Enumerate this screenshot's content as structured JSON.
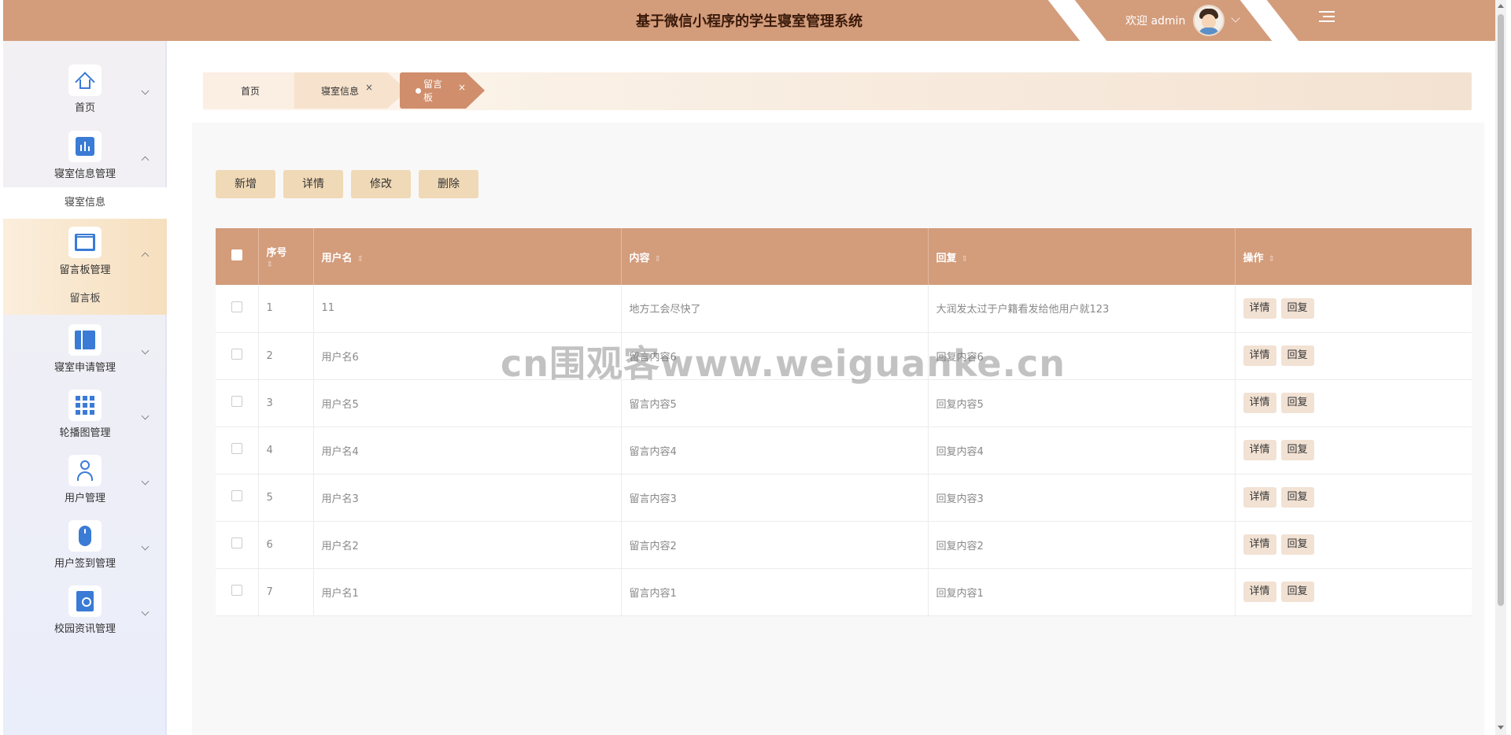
{
  "header": {
    "title": "基于微信小程序的学生寝室管理系统",
    "welcome": "欢迎 admin",
    "accent_color": "#d39c7b"
  },
  "sidebar": {
    "items": [
      {
        "label": "首页",
        "icon": "home-icon"
      },
      {
        "label": "寝室信息管理",
        "icon": "chart-icon",
        "sub": [
          "寝室信息"
        ]
      },
      {
        "label": "留言板管理",
        "icon": "window-icon",
        "sub": [
          "留言板"
        ]
      },
      {
        "label": "寝室申请管理",
        "icon": "book-icon"
      },
      {
        "label": "轮播图管理",
        "icon": "grid-icon"
      },
      {
        "label": "用户管理",
        "icon": "user-icon"
      },
      {
        "label": "用户签到管理",
        "icon": "mouse-icon"
      },
      {
        "label": "校园资讯管理",
        "icon": "id-card-icon"
      }
    ]
  },
  "tabs": [
    {
      "label": "首页"
    },
    {
      "label": "寝室信息",
      "close": "×"
    },
    {
      "label": "留言板",
      "close": "×",
      "active": true
    }
  ],
  "toolbar": {
    "add": "新增",
    "detail": "详情",
    "edit": "修改",
    "delete": "删除"
  },
  "table": {
    "columns": [
      "序号",
      "用户名",
      "内容",
      "回复",
      "操作"
    ],
    "rows": [
      {
        "no": "1",
        "user": "11",
        "content": "地方工会尽快了",
        "reply": "大润发太过于户籍看发给他用户就123"
      },
      {
        "no": "2",
        "user": "用户名6",
        "content": "留言内容6",
        "reply": "回复内容6"
      },
      {
        "no": "3",
        "user": "用户名5",
        "content": "留言内容5",
        "reply": "回复内容5"
      },
      {
        "no": "4",
        "user": "用户名4",
        "content": "留言内容4",
        "reply": "回复内容4"
      },
      {
        "no": "5",
        "user": "用户名3",
        "content": "留言内容3",
        "reply": "回复内容3"
      },
      {
        "no": "6",
        "user": "用户名2",
        "content": "留言内容2",
        "reply": "回复内容2"
      },
      {
        "no": "7",
        "user": "用户名1",
        "content": "留言内容1",
        "reply": "回复内容1"
      }
    ],
    "row_actions": {
      "detail": "详情",
      "reply": "回复"
    }
  },
  "watermark": "cn围观客www.weiguanke.cn"
}
